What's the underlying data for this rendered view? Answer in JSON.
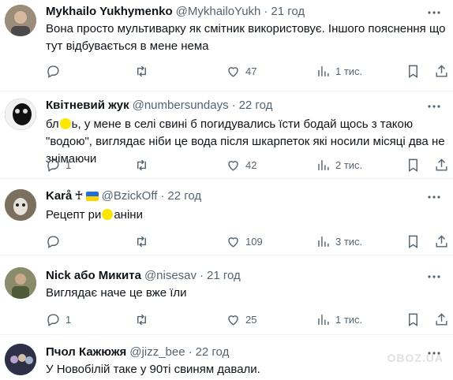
{
  "tweets": [
    {
      "name": "Mykhailo Yukhymenko",
      "handle": "@MykhailoYukh",
      "dot": "·",
      "time": "21 год",
      "text": "Вона просто мультиварку як смітник використовує. Іншого пояснення що тут відбувається в мене нема",
      "replies": "",
      "likes": "47",
      "views": "1 тис.",
      "avatar_color": "#8a7a6a"
    },
    {
      "name": "Квітневий жук",
      "handle": "@numbersundays",
      "dot": "·",
      "time": "22 год",
      "text_pre": "бл",
      "text_post": "ь, у мене в селі свині б погидувались їсти бодай щось з такою \"водою\", виглядає ніби це вода після шкарпеток які носили місяці два не знімаючи",
      "replies": "1",
      "likes": "42",
      "views": "2 тис.",
      "avatar_color": "#1a1a1a"
    },
    {
      "name": "Karå",
      "badge": "♰",
      "handle": "@BzickOff",
      "dot": "·",
      "time": "22 год",
      "text_pre": "Рецепт ри",
      "text_post": "аніни",
      "replies": "",
      "likes": "109",
      "views": "3 тис.",
      "avatar_color": "#6b6355"
    },
    {
      "name": "Nick або Микита",
      "handle": "@nisesav",
      "dot": "·",
      "time": "21 год",
      "text": "Виглядає наче це вже їли",
      "replies": "1",
      "likes": "25",
      "views": "1 тис.",
      "avatar_color": "#6d6f4f"
    },
    {
      "name": "Пчол Кажюжя",
      "handle": "@jizz_bee",
      "dot": "·",
      "time": "22 год",
      "text": "У Новобілій таке у 90ті свиням давали.",
      "avatar_color": "#3a3d55"
    }
  ],
  "watermark": "OBOZ.UA",
  "colors": {
    "text": "#0f1419",
    "secondary": "#536471",
    "divider": "#eff3f4"
  }
}
